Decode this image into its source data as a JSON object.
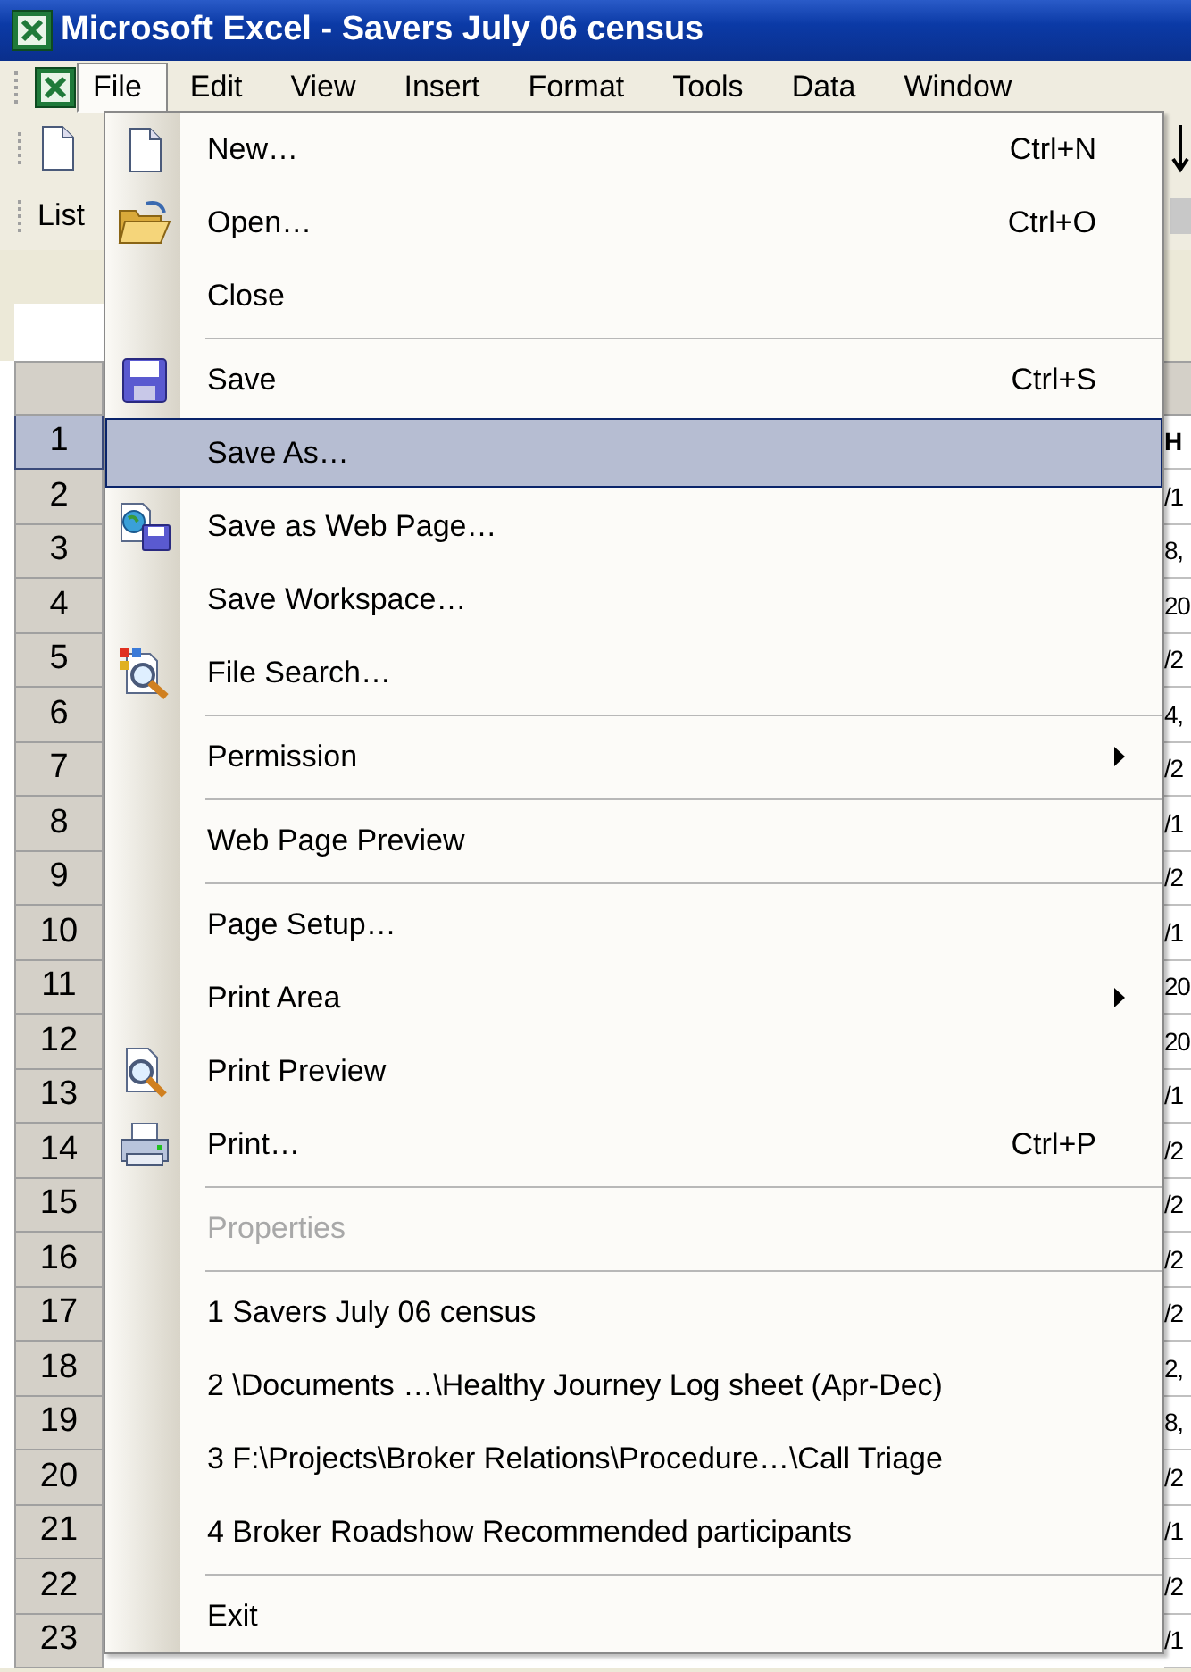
{
  "window": {
    "title": "Microsoft Excel - Savers July 06 census"
  },
  "menubar": [
    {
      "label": "File",
      "selected": true
    },
    {
      "label": "Edit",
      "selected": false
    },
    {
      "label": "View",
      "selected": false
    },
    {
      "label": "Insert",
      "selected": false
    },
    {
      "label": "Format",
      "selected": false
    },
    {
      "label": "Tools",
      "selected": false
    },
    {
      "label": "Data",
      "selected": false
    },
    {
      "label": "Window",
      "selected": false
    }
  ],
  "list_toolbar": {
    "label": "List"
  },
  "file_menu": {
    "items": [
      {
        "kind": "item",
        "label": "New…",
        "shortcut": "Ctrl+N",
        "selected": false,
        "disabled": false,
        "submenu": false
      },
      {
        "kind": "item",
        "label": "Open…",
        "shortcut": "Ctrl+O",
        "selected": false,
        "disabled": false,
        "submenu": false
      },
      {
        "kind": "item",
        "label": "Close",
        "selected": false,
        "disabled": false,
        "submenu": false
      },
      {
        "kind": "separator"
      },
      {
        "kind": "item",
        "label": "Save",
        "shortcut": "Ctrl+S",
        "selected": false,
        "disabled": false,
        "submenu": false
      },
      {
        "kind": "item",
        "label": "Save As…",
        "selected": true,
        "disabled": false,
        "submenu": false
      },
      {
        "kind": "item",
        "label": "Save as Web Page…",
        "selected": false,
        "disabled": false,
        "submenu": false
      },
      {
        "kind": "item",
        "label": "Save Workspace…",
        "selected": false,
        "disabled": false,
        "submenu": false
      },
      {
        "kind": "item",
        "label": "File Search…",
        "selected": false,
        "disabled": false,
        "submenu": false
      },
      {
        "kind": "separator"
      },
      {
        "kind": "item",
        "label": "Permission",
        "selected": false,
        "disabled": false,
        "submenu": true
      },
      {
        "kind": "separator"
      },
      {
        "kind": "item",
        "label": "Web Page Preview",
        "selected": false,
        "disabled": false,
        "submenu": false
      },
      {
        "kind": "separator"
      },
      {
        "kind": "item",
        "label": "Page Setup…",
        "selected": false,
        "disabled": false,
        "submenu": false
      },
      {
        "kind": "item",
        "label": "Print Area",
        "selected": false,
        "disabled": false,
        "submenu": true
      },
      {
        "kind": "item",
        "label": "Print Preview",
        "selected": false,
        "disabled": false,
        "submenu": false
      },
      {
        "kind": "item",
        "label": "Print…",
        "shortcut": "Ctrl+P",
        "selected": false,
        "disabled": false,
        "submenu": false
      },
      {
        "kind": "separator"
      },
      {
        "kind": "item",
        "label": "Properties",
        "selected": false,
        "disabled": true,
        "submenu": false
      },
      {
        "kind": "separator"
      },
      {
        "kind": "item",
        "label": "1 Savers July 06 census",
        "selected": false,
        "disabled": false,
        "submenu": false
      },
      {
        "kind": "item",
        "label": "2 \\Documents …\\Healthy Journey Log sheet (Apr-Dec)",
        "selected": false,
        "disabled": false,
        "submenu": false
      },
      {
        "kind": "item",
        "label": "3 F:\\Projects\\Broker Relations\\Procedure…\\Call Triage",
        "selected": false,
        "disabled": false,
        "submenu": false
      },
      {
        "kind": "item",
        "label": "4 Broker Roadshow Recommended participants",
        "selected": false,
        "disabled": false,
        "submenu": false
      },
      {
        "kind": "separator"
      },
      {
        "kind": "item",
        "label": "Exit",
        "selected": false,
        "disabled": false,
        "submenu": false
      }
    ]
  },
  "sheet": {
    "rows": [
      {
        "header": "1",
        "selected": true,
        "column_3": "H"
      },
      {
        "header": "2",
        "selected": false,
        "column_3": "/1"
      },
      {
        "header": "3",
        "selected": false,
        "column_3": "8,"
      },
      {
        "header": "4",
        "selected": false,
        "column_3": "20"
      },
      {
        "header": "5",
        "selected": false,
        "column_3": "/2"
      },
      {
        "header": "6",
        "selected": false,
        "column_3": "4,"
      },
      {
        "header": "7",
        "selected": false,
        "column_3": "/2"
      },
      {
        "header": "8",
        "selected": false,
        "column_3": "/1"
      },
      {
        "header": "9",
        "selected": false,
        "column_3": "/2"
      },
      {
        "header": "10",
        "selected": false,
        "column_3": "/1"
      },
      {
        "header": "11",
        "selected": false,
        "column_3": "20"
      },
      {
        "header": "12",
        "selected": false,
        "column_3": "20"
      },
      {
        "header": "13",
        "selected": false,
        "column_3": "/1"
      },
      {
        "header": "14",
        "selected": false,
        "column_3": "/2"
      },
      {
        "header": "15",
        "selected": false,
        "column_3": "/2"
      },
      {
        "header": "16",
        "selected": false,
        "column_3": "/2"
      },
      {
        "header": "17",
        "selected": false,
        "column_3": "/2"
      },
      {
        "header": "18",
        "selected": false,
        "column_3": "2,"
      },
      {
        "header": "19",
        "selected": false,
        "column_3": "8,"
      },
      {
        "header": "20",
        "selected": false,
        "column_3": "/2"
      },
      {
        "header": "21",
        "selected": false,
        "column_3": "/1"
      },
      {
        "header": "22",
        "selected": false,
        "column_3": "/2"
      },
      {
        "header": "23",
        "selected": false,
        "column_3": "/1"
      }
    ]
  }
}
